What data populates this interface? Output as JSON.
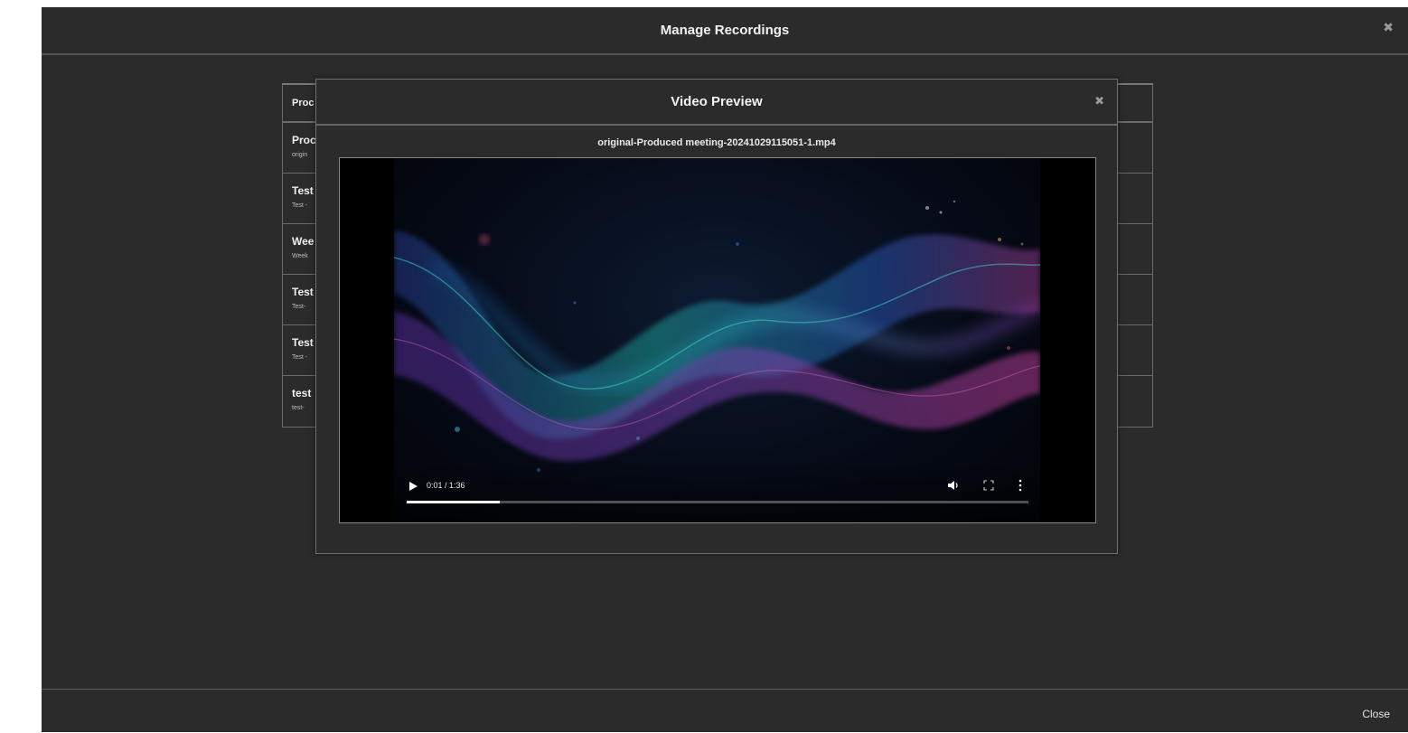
{
  "manage": {
    "title": "Manage Recordings",
    "close_glyph": "✖",
    "footer_close_label": "Close"
  },
  "recordings": {
    "header_label": "Proc",
    "rows": [
      {
        "title": "Proc",
        "sub": "origin"
      },
      {
        "title": "Test",
        "sub": "Test -"
      },
      {
        "title": "Wee",
        "sub": "Week"
      },
      {
        "title": "Test",
        "sub": "Test-"
      },
      {
        "title": "Test",
        "sub": "Test -"
      },
      {
        "title": "test",
        "sub": "test-"
      }
    ]
  },
  "video_preview": {
    "title": "Video Preview",
    "close_glyph": "✖",
    "filename": "original-Produced meeting-20241029115051-1.mp4",
    "time": "0:01 / 1:36",
    "progress": 0.15
  },
  "colors": {
    "background": "#2b2b2b",
    "wave_teal": "#1fb5a8",
    "wave_purple": "#7a3fb0",
    "wave_pink": "#c2409a",
    "wave_blue": "#2a5fc8"
  },
  "icons": [
    "close-icon",
    "play-icon",
    "volume-icon",
    "fullscreen-icon",
    "more-vert-icon"
  ]
}
